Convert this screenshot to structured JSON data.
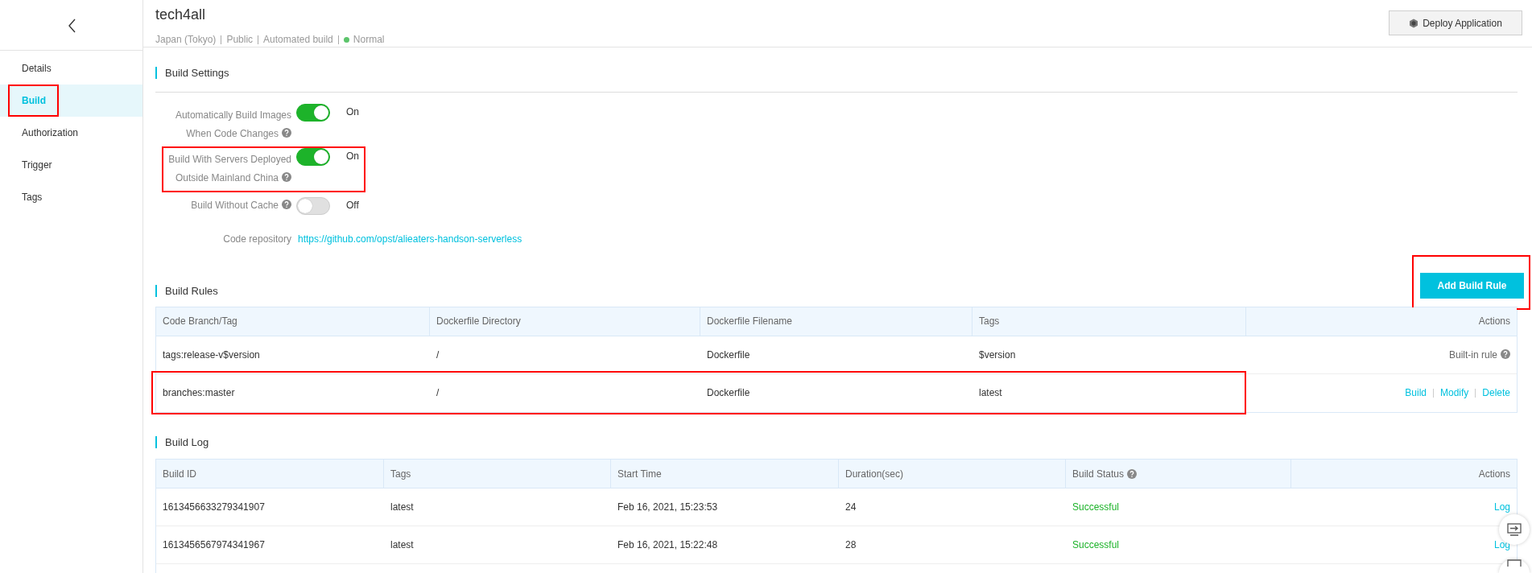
{
  "sidebar": {
    "items": [
      {
        "label": "Details",
        "selected": false,
        "highlighted": false
      },
      {
        "label": "Build",
        "selected": true,
        "highlighted": true
      },
      {
        "label": "Authorization",
        "selected": false,
        "highlighted": false
      },
      {
        "label": "Trigger",
        "selected": false,
        "highlighted": false
      },
      {
        "label": "Tags",
        "selected": false,
        "highlighted": false
      }
    ]
  },
  "header": {
    "title": "tech4all",
    "meta": [
      "Japan (Tokyo)",
      "Public",
      "Automated build"
    ],
    "status": {
      "label": "Normal"
    },
    "deploy_button": "Deploy Application"
  },
  "build_settings": {
    "title": "Build Settings",
    "settings": [
      {
        "label_lines": [
          "Automatically Build Images",
          "When Code Changes"
        ],
        "on": true,
        "state_label": "On",
        "highlighted": false
      },
      {
        "label_lines": [
          "Build With Servers Deployed",
          "Outside Mainland China"
        ],
        "on": true,
        "state_label": "On",
        "highlighted": true
      },
      {
        "label_lines": [
          "Build Without Cache"
        ],
        "on": false,
        "state_label": "Off",
        "highlighted": false
      }
    ],
    "repository": {
      "label": "Code repository",
      "url": "https://github.com/opst/alieaters-handson-serverless"
    }
  },
  "build_rules": {
    "title": "Build Rules",
    "add_button": {
      "label": "Add Build Rule",
      "highlighted": true
    },
    "columns": [
      "Code Branch/Tag",
      "Dockerfile Directory",
      "Dockerfile Filename",
      "Tags",
      "Actions"
    ],
    "rows": [
      {
        "cells": [
          "tags:release-v$version",
          "/",
          "Dockerfile",
          "$version"
        ],
        "kind": "builtin",
        "note": "Built-in rule",
        "highlighted": false
      },
      {
        "cells": [
          "branches:master",
          "/",
          "Dockerfile",
          "latest"
        ],
        "kind": "custom",
        "actions": [
          "Build",
          "Modify",
          "Delete"
        ],
        "highlighted": true
      }
    ]
  },
  "build_log": {
    "title": "Build Log",
    "columns": [
      {
        "label": "Build ID",
        "help": false
      },
      {
        "label": "Tags",
        "help": false
      },
      {
        "label": "Start Time",
        "help": false
      },
      {
        "label": "Duration(sec)",
        "help": false
      },
      {
        "label": "Build Status",
        "help": true
      },
      {
        "label": "Actions",
        "help": false
      }
    ],
    "rows": [
      {
        "cells": [
          "1613456633279341907",
          "latest",
          "Feb 16, 2021, 15:23:53",
          "24"
        ],
        "status": "Successful",
        "action": "Log"
      },
      {
        "cells": [
          "1613456567974341967",
          "latest",
          "Feb 16, 2021, 15:22:48",
          "28"
        ],
        "status": "Successful",
        "action": "Log"
      }
    ]
  }
}
